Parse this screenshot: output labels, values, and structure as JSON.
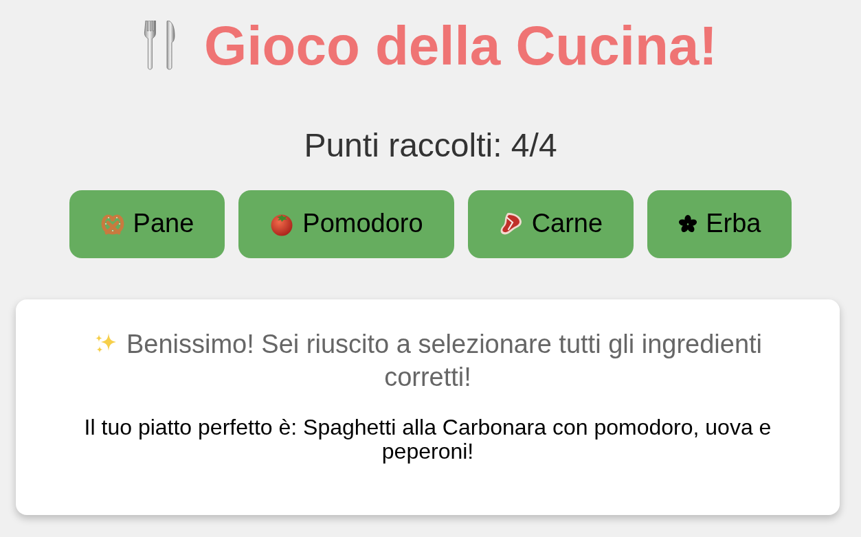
{
  "title": "Gioco della Cucina!",
  "score": "Punti raccolti: 4/4",
  "ingredients": [
    {
      "label": "Pane"
    },
    {
      "label": "Pomodoro"
    },
    {
      "label": "Carne"
    },
    {
      "label": "Erba"
    }
  ],
  "result": {
    "message": "Benissimo! Sei riuscito a selezionare tutti gli ingredienti corretti!",
    "dish": "Il tuo piatto perfetto è: Spaghetti alla Carbonara con pomodoro, uova e peperoni!"
  }
}
